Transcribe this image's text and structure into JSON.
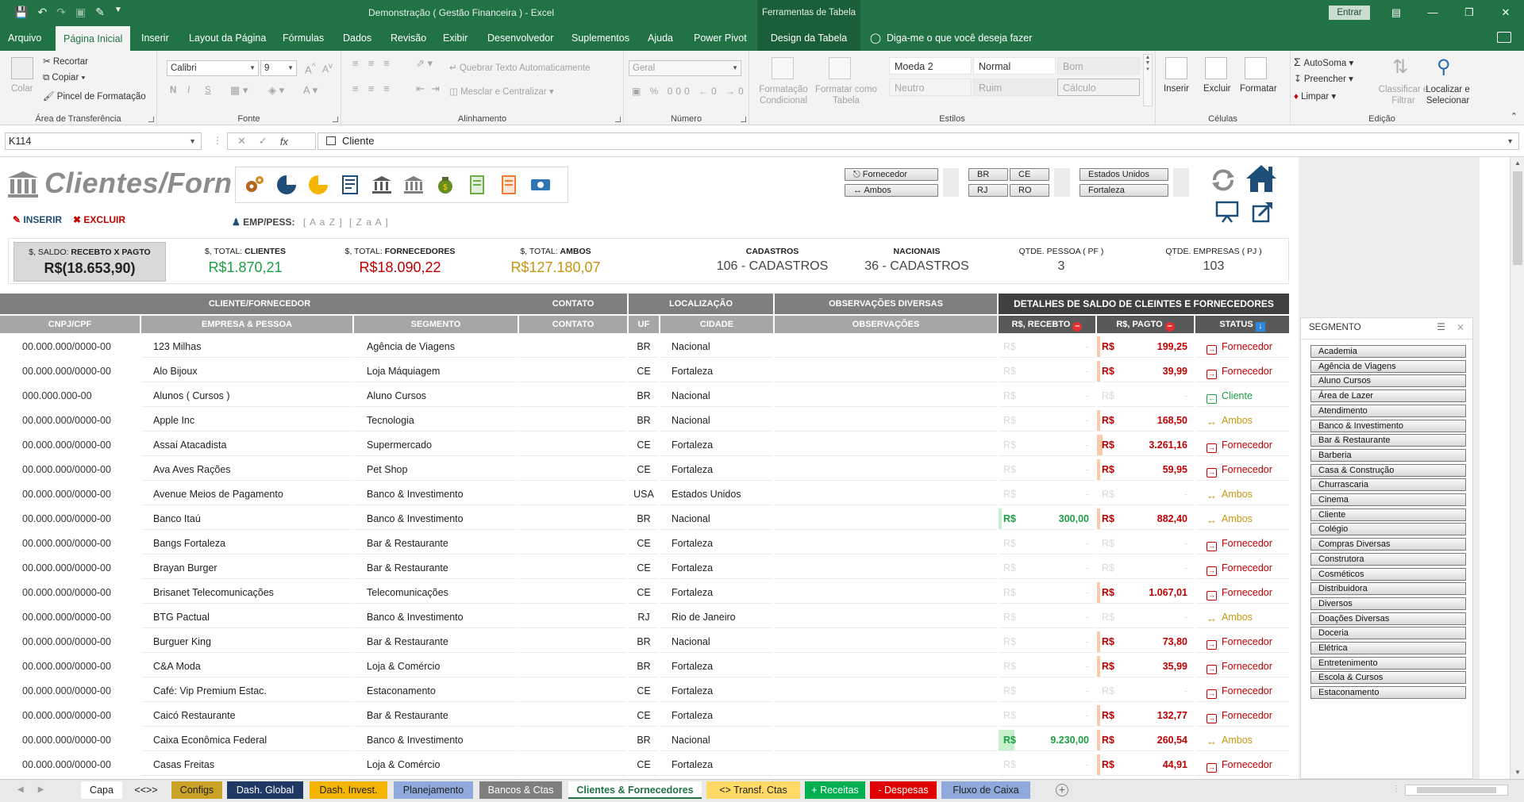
{
  "titlebar": {
    "doc_title": "Demonstração ( Gestão Financeira )  -  Excel",
    "tool_tab_title": "Ferramentas de Tabela",
    "entrar_label": "Entrar"
  },
  "ribbon_tabs": [
    {
      "label": "Arquivo"
    },
    {
      "label": "Página Inicial",
      "active": true
    },
    {
      "label": "Inserir"
    },
    {
      "label": "Layout da Página"
    },
    {
      "label": "Fórmulas"
    },
    {
      "label": "Dados"
    },
    {
      "label": "Revisão"
    },
    {
      "label": "Exibir"
    },
    {
      "label": "Desenvolvedor"
    },
    {
      "label": "Suplementos"
    },
    {
      "label": "Ajuda"
    },
    {
      "label": "Power Pivot"
    },
    {
      "label": "Design da Tabela"
    }
  ],
  "tellme": "Diga-me o que você deseja fazer",
  "ribbon": {
    "clipboard": {
      "paste": "Colar",
      "cut": "Recortar",
      "copy": "Copiar",
      "format_painter": "Pincel de Formatação",
      "label": "Área de Transferência"
    },
    "font": {
      "name": "Calibri",
      "size": "9",
      "label": "Fonte",
      "bold": "N",
      "italic": "I",
      "underline": "S"
    },
    "alignment": {
      "wrap": "Quebrar Texto Automaticamente",
      "merge": "Mesclar e Centralizar",
      "label": "Alinhamento"
    },
    "number": {
      "format": "Geral",
      "label": "Número"
    },
    "styles": {
      "cond_format": "Formatação Condicional",
      "format_table": "Formatar como Tabela",
      "cells": [
        "Moeda 2",
        "Normal",
        "Bom",
        "Neutro",
        "Ruim",
        "Cálculo"
      ],
      "label": "Estilos"
    },
    "cells": {
      "insert": "Inserir",
      "delete": "Excluir",
      "format": "Formatar",
      "label": "Células"
    },
    "editing": {
      "autosum": "AutoSoma",
      "fill": "Preencher",
      "clear": "Limpar",
      "sort": "Classificar e Filtrar",
      "find": "Localizar e Selecionar",
      "label": "Edição"
    }
  },
  "formula": {
    "namebox": "K114",
    "content": "Cliente"
  },
  "sheet": {
    "app_title": "Clientes/Forn",
    "actions": {
      "insert": "INSERIR",
      "delete": "EXCLUIR"
    },
    "emp_label": "EMP/PESS:",
    "sort_az": "[ A a Z ]",
    "sort_za": "[ Z a A ]",
    "filters": {
      "type": [
        "Fornecedor",
        "Ambos"
      ],
      "uf": [
        "BR",
        "CE",
        "RJ",
        "RO"
      ],
      "city": [
        "Estados Unidos",
        "Fortaleza"
      ]
    },
    "kpis": [
      {
        "label_pre": "$, SALDO:",
        "label_bold": "RECEBTO X PAGTO",
        "value": "R$(18.653,90)",
        "color": "#222222"
      },
      {
        "label_pre": "$, TOTAL:",
        "label_bold": "CLIENTES",
        "value": "R$1.870,21",
        "color": "#1e9e45"
      },
      {
        "label_pre": "$, TOTAL:",
        "label_bold": "FORNECEDORES",
        "value": "R$18.090,22",
        "color": "#c00000"
      },
      {
        "label_pre": "$, TOTAL:",
        "label_bold": "AMBOS",
        "value": "R$127.180,07",
        "color": "#c7960e"
      },
      {
        "label_pre": "",
        "label_bold": "CADASTROS",
        "value": "106 - CADASTROS",
        "color": "#444444"
      },
      {
        "label_pre": "",
        "label_bold": "NACIONAIS",
        "value": "36 - CADASTROS",
        "color": "#444444"
      },
      {
        "label_pre": "QTDE. PESSOA ( PF )",
        "label_bold": "",
        "value": "3",
        "color": "#444444"
      },
      {
        "label_pre": "QTDE. EMPRESAS ( PJ )",
        "label_bold": "",
        "value": "103",
        "color": "#444444"
      }
    ],
    "groups": {
      "cliente_fornecedor": "CLIENTE/FORNECEDOR",
      "contato": "CONTATO",
      "localizacao": "LOCALIZAÇÃO",
      "observacoes": "OBSERVAÇÕES DIVERSAS",
      "detalhes": "DETALHES DE SALDO DE CLEINTES E FORNECEDORES"
    },
    "columns": {
      "cnpj": "CNPJ/CPF",
      "empresa": "EMPRESA & PESSOA",
      "segmento": "SEGMENTO",
      "contato": "CONTATO",
      "uf": "UF",
      "cidade": "CIDADE",
      "obs": "OBSERVAÇÕES",
      "recebto": "R$, RECEBTO",
      "pagto": "R$, PAGTO",
      "status": "STATUS"
    },
    "currency": "R$",
    "rows": [
      {
        "cnpj": "00.000.000/0000-00",
        "empresa": "123 Milhas",
        "segmento": "Agência de Viagens",
        "uf": "BR",
        "cidade": "Nacional",
        "recebto": "",
        "pagto": "199,25",
        "status": "Fornecedor"
      },
      {
        "cnpj": "00.000.000/0000-00",
        "empresa": "Alo Bijoux",
        "segmento": "Loja Máquiagem",
        "uf": "CE",
        "cidade": "Fortaleza",
        "recebto": "",
        "pagto": "39,99",
        "status": "Fornecedor"
      },
      {
        "cnpj": "000.000.000-00",
        "empresa": "Alunos ( Cursos )",
        "segmento": "Aluno Cursos",
        "uf": "BR",
        "cidade": "Nacional",
        "recebto": "",
        "pagto": "",
        "status": "Cliente"
      },
      {
        "cnpj": "00.000.000/0000-00",
        "empresa": "Apple Inc",
        "segmento": "Tecnologia",
        "uf": "BR",
        "cidade": "Nacional",
        "recebto": "",
        "pagto": "168,50",
        "status": "Ambos"
      },
      {
        "cnpj": "00.000.000/0000-00",
        "empresa": "Assaí Atacadista",
        "segmento": "Supermercado",
        "uf": "CE",
        "cidade": "Fortaleza",
        "recebto": "",
        "pagto": "3.261,16",
        "status": "Fornecedor",
        "pagto_bar": 0.06
      },
      {
        "cnpj": "00.000.000/0000-00",
        "empresa": "Ava Aves Rações",
        "segmento": "Pet Shop",
        "uf": "CE",
        "cidade": "Fortaleza",
        "recebto": "",
        "pagto": "59,95",
        "status": "Fornecedor"
      },
      {
        "cnpj": "00.000.000/0000-00",
        "empresa": "Avenue Meios de Pagamento",
        "segmento": "Banco & Investimento",
        "uf": "USA",
        "cidade": "Estados Unidos",
        "recebto": "",
        "pagto": "",
        "status": "Ambos"
      },
      {
        "cnpj": "00.000.000/0000-00",
        "empresa": "Banco Itaú",
        "segmento": "Banco & Investimento",
        "uf": "BR",
        "cidade": "Nacional",
        "recebto": "300,00",
        "pagto": "882,40",
        "status": "Ambos"
      },
      {
        "cnpj": "00.000.000/0000-00",
        "empresa": "Bangs Fortaleza",
        "segmento": "Bar & Restaurante",
        "uf": "CE",
        "cidade": "Fortaleza",
        "recebto": "",
        "pagto": "",
        "status": "Fornecedor"
      },
      {
        "cnpj": "00.000.000/0000-00",
        "empresa": "Brayan Burger",
        "segmento": "Bar & Restaurante",
        "uf": "CE",
        "cidade": "Fortaleza",
        "recebto": "",
        "pagto": "",
        "status": "Fornecedor"
      },
      {
        "cnpj": "00.000.000/0000-00",
        "empresa": "Brisanet Telecomunicações",
        "segmento": "Telecomunicações",
        "uf": "CE",
        "cidade": "Fortaleza",
        "recebto": "",
        "pagto": "1.067,01",
        "status": "Fornecedor",
        "pagto_bar": 0.02
      },
      {
        "cnpj": "00.000.000/0000-00",
        "empresa": "BTG Pactual",
        "segmento": "Banco & Investimento",
        "uf": "RJ",
        "cidade": "Rio de Janeiro",
        "recebto": "",
        "pagto": "",
        "status": "Ambos"
      },
      {
        "cnpj": "00.000.000/0000-00",
        "empresa": "Burguer King",
        "segmento": "Bar & Restaurante",
        "uf": "BR",
        "cidade": "Nacional",
        "recebto": "",
        "pagto": "73,80",
        "status": "Fornecedor"
      },
      {
        "cnpj": "00.000.000/0000-00",
        "empresa": "C&A Moda",
        "segmento": "Loja & Comércio",
        "uf": "BR",
        "cidade": "Fortaleza",
        "recebto": "",
        "pagto": "35,99",
        "status": "Fornecedor"
      },
      {
        "cnpj": "00.000.000/0000-00",
        "empresa": "Café: Vip Premium Estac.",
        "segmento": "Estaconamento",
        "uf": "CE",
        "cidade": "Fortaleza",
        "recebto": "",
        "pagto": "",
        "status": "Fornecedor"
      },
      {
        "cnpj": "00.000.000/0000-00",
        "empresa": "Caicó Restaurante",
        "segmento": "Bar & Restaurante",
        "uf": "CE",
        "cidade": "Fortaleza",
        "recebto": "",
        "pagto": "132,77",
        "status": "Fornecedor"
      },
      {
        "cnpj": "00.000.000/0000-00",
        "empresa": "Caixa Econômica Federal",
        "segmento": "Banco & Investimento",
        "uf": "BR",
        "cidade": "Nacional",
        "recebto": "9.230,00",
        "pagto": "260,54",
        "status": "Ambos",
        "recebto_bar": 0.16
      },
      {
        "cnpj": "00.000.000/0000-00",
        "empresa": "Casas Freitas",
        "segmento": "Loja & Comércio",
        "uf": "CE",
        "cidade": "Fortaleza",
        "recebto": "",
        "pagto": "44,91",
        "status": "Fornecedor"
      }
    ]
  },
  "segment_panel": {
    "title": "SEGMENTO",
    "items": [
      "Academia",
      "Agência de Viagens",
      "Aluno Cursos",
      "Área de Lazer",
      "Atendimento",
      "Banco & Investimento",
      "Bar & Restaurante",
      "Barberia",
      "Casa & Construção",
      "Churrascaria",
      "Cinema",
      "Cliente",
      "Colégio",
      "Compras Diversas",
      "Construtora",
      "Cosméticos",
      "Distribuidora",
      "Diversos",
      "Doações Diversas",
      "Doceria",
      "Elétrica",
      "Entretenimento",
      "Escola & Cursos",
      "Estaconamento"
    ]
  },
  "sheet_tabs": [
    {
      "label": "Capa",
      "bg": "#ffffff",
      "color": "#222222"
    },
    {
      "label": "<<>>",
      "bg": "#e9e9e9",
      "color": "#222222"
    },
    {
      "label": "Configs",
      "bg": "#c9a227",
      "color": "#222222"
    },
    {
      "label": "Dash. Global",
      "bg": "#1f3864",
      "color": "#ffffff"
    },
    {
      "label": "Dash. Invest.",
      "bg": "#f4b400",
      "color": "#222222"
    },
    {
      "label": "Planejamento",
      "bg": "#8ea9db",
      "color": "#222222"
    },
    {
      "label": "Bancos & Ctas",
      "bg": "#7f7f7f",
      "color": "#ffffff"
    },
    {
      "label": "Clientes & Fornecedores",
      "bg": "#ffffff",
      "color": "#217346",
      "active": true
    },
    {
      "label": "<> Transf. Ctas",
      "bg": "#ffd966",
      "color": "#222222"
    },
    {
      "label": "+ Receitas",
      "bg": "#00b050",
      "color": "#ffffff"
    },
    {
      "label": "- Despesas",
      "bg": "#e00000",
      "color": "#ffffff"
    },
    {
      "label": "Fluxo de Caixa",
      "bg": "#8ea9db",
      "color": "#222222"
    }
  ]
}
